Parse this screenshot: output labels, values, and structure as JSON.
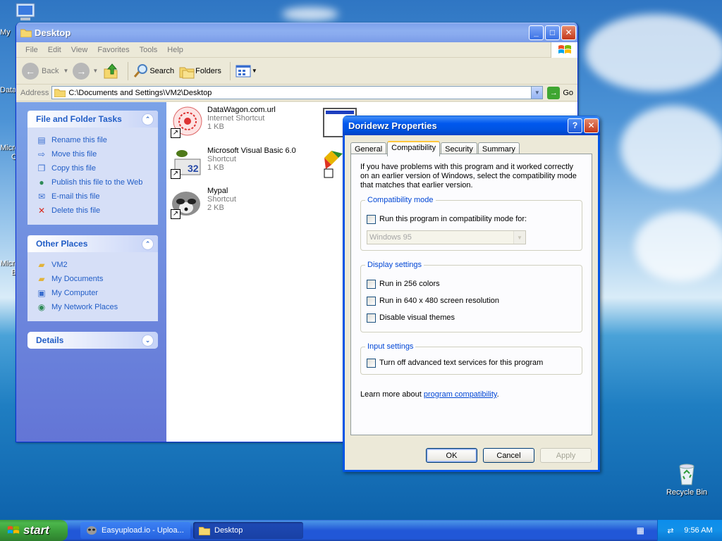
{
  "desktop": {
    "icon_labels": [
      "My",
      "Data",
      "Micro",
      "C",
      "Micro",
      "B"
    ],
    "recycle_bin": "Recycle Bin"
  },
  "explorer": {
    "title": "Desktop",
    "menu": [
      "File",
      "Edit",
      "View",
      "Favorites",
      "Tools",
      "Help"
    ],
    "toolbar": {
      "back": "Back",
      "search": "Search",
      "folders": "Folders"
    },
    "address": {
      "label": "Address",
      "value": "C:\\Documents and Settings\\VM2\\Desktop",
      "go": "Go"
    },
    "tasks_panel": {
      "title": "File and Folder Tasks",
      "items": [
        "Rename this file",
        "Move this file",
        "Copy this file",
        "Publish this file to the Web",
        "E-mail this file",
        "Delete this file"
      ]
    },
    "places_panel": {
      "title": "Other Places",
      "items": [
        "VM2",
        "My Documents",
        "My Computer",
        "My Network Places"
      ]
    },
    "details_panel": {
      "title": "Details"
    },
    "files": [
      {
        "name": "DataWagon.com.url",
        "type": "Internet Shortcut",
        "size": "1 KB"
      },
      {
        "name": "Microsoft Visual Basic 6.0",
        "type": "Shortcut",
        "size": "1 KB"
      },
      {
        "name": "Mypal",
        "type": "Shortcut",
        "size": "2 KB"
      }
    ]
  },
  "dialog": {
    "title": "Doridewz Properties",
    "tabs": [
      "General",
      "Compatibility",
      "Security",
      "Summary"
    ],
    "intro": "If you have problems with this program and it worked correctly on an earlier version of Windows, select the compatibility mode that matches that earlier version.",
    "compat_group": {
      "legend": "Compatibility mode",
      "checkbox": "Run this program in compatibility mode for:",
      "select_value": "Windows 95"
    },
    "display_group": {
      "legend": "Display settings",
      "items": [
        "Run in 256 colors",
        "Run in 640 x 480 screen resolution",
        "Disable visual themes"
      ]
    },
    "input_group": {
      "legend": "Input settings",
      "checkbox": "Turn off advanced text services for this program"
    },
    "learn_prefix": "Learn more about ",
    "learn_link": "program compatibility",
    "learn_suffix": ".",
    "buttons": {
      "ok": "OK",
      "cancel": "Cancel",
      "apply": "Apply"
    }
  },
  "taskbar": {
    "start": "start",
    "tasks": [
      "Easyupload.io - Uploa...",
      "Desktop"
    ],
    "clock": "9:56 AM"
  }
}
